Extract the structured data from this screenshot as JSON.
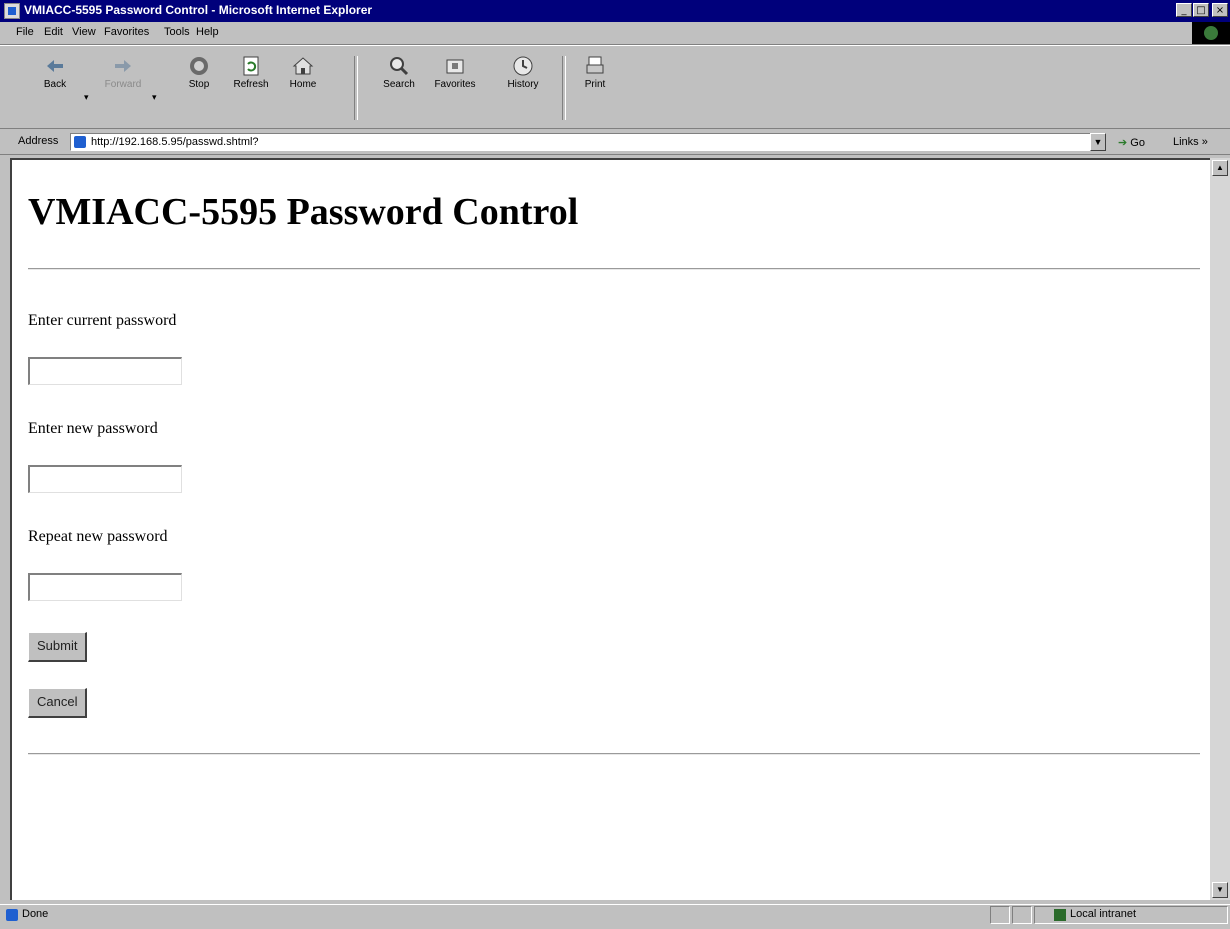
{
  "window": {
    "title": "VMIACC-5595 Password Control - Microsoft Internet Explorer",
    "controls": {
      "minimize": "_",
      "maximize": "□",
      "close": "×"
    }
  },
  "menu": {
    "items": [
      {
        "label": "File"
      },
      {
        "label": "Edit"
      },
      {
        "label": "View"
      },
      {
        "label": "Favorites"
      },
      {
        "label": "Tools"
      },
      {
        "label": "Help"
      }
    ]
  },
  "toolbar": {
    "back": "Back",
    "forward": "Forward",
    "stop": "Stop",
    "refresh": "Refresh",
    "home": "Home",
    "search": "Search",
    "favorites": "Favorites",
    "history": "History",
    "print": "Print"
  },
  "address_bar": {
    "label": "Address",
    "url": "http://192.168.5.95/passwd.shtml?",
    "go": "Go",
    "links": "Links »"
  },
  "page": {
    "title": "VMIACC-5595 Password Control",
    "form": {
      "current_password_label": "Enter current password",
      "new_password_label": "Enter new password",
      "repeat_password_label": "Repeat new password",
      "current_password_value": "",
      "new_password_value": "",
      "repeat_password_value": "",
      "submit": "Submit",
      "cancel": "Cancel"
    }
  },
  "status_bar": {
    "text": "Done",
    "zone": "Local intranet"
  },
  "colors": {
    "title_bar": "#00007b",
    "chrome": "#c0c0c0",
    "content_bg": "#ffffff"
  }
}
